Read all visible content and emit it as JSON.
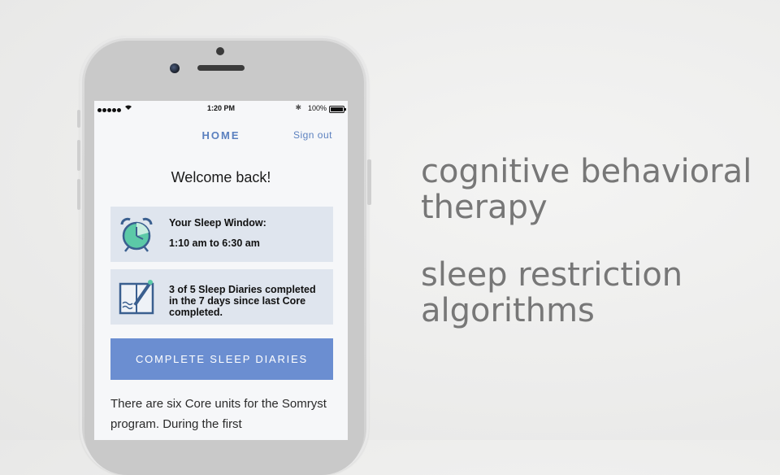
{
  "status_bar": {
    "time": "1:20 PM",
    "battery": "100%"
  },
  "nav": {
    "title": "HOME",
    "sign_out": "Sign out"
  },
  "welcome": "Welcome back!",
  "sleep_window": {
    "title": "Your Sleep Window:",
    "time": "1:10 am to 6:30 am",
    "icon": "alarm-clock-icon"
  },
  "diaries": {
    "text": "3 of 5 Sleep Diaries completed in the 7 days since last Core completed.",
    "icon": "diary-pencil-icon"
  },
  "cta": {
    "label": "COMPLETE SLEEP DIARIES"
  },
  "body_text": "There are six Core units for the Somryst program. During the first",
  "tagline": {
    "line1a": "cognitive behavioral",
    "line1b": "therapy",
    "line2a": "sleep restriction",
    "line2b": "algorithms"
  },
  "colors": {
    "accent": "#5b80bf",
    "button": "#6b8ed1",
    "card": "#dfe5ee",
    "icon_teal": "#5cc9a7",
    "icon_navy": "#3a5f8f"
  }
}
